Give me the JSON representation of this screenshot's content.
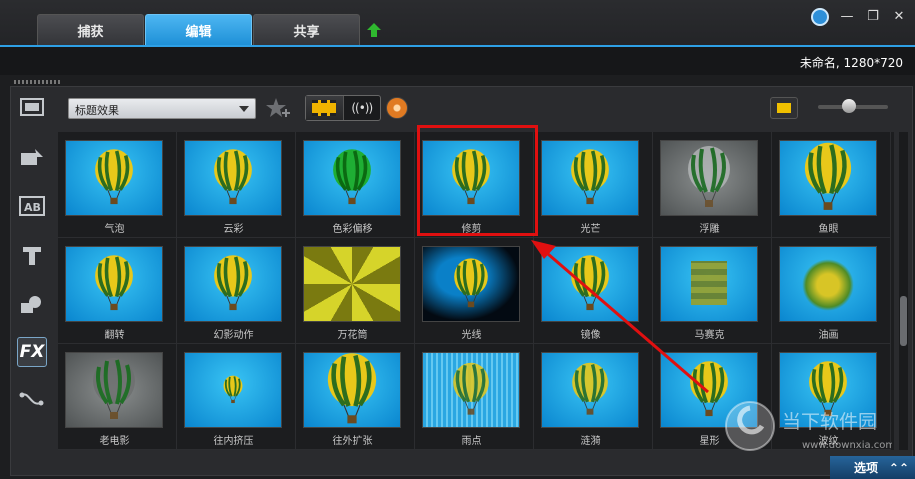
{
  "tabs": [
    {
      "label": "捕获",
      "active": false
    },
    {
      "label": "编辑",
      "active": true
    },
    {
      "label": "共享",
      "active": false
    }
  ],
  "project_info": "未命名, 1280*720",
  "toolbar": {
    "category": "标题效果"
  },
  "sidebar": [
    "media-icon",
    "transition-icon",
    "title-ab-icon",
    "text-t-icon",
    "graphics-icon",
    "fx-icon",
    "path-icon"
  ],
  "sidebar_fx_label": "FX",
  "effects": [
    {
      "label": "气泡",
      "thumb": "bubbles"
    },
    {
      "label": "云彩",
      "thumb": "clouds"
    },
    {
      "label": "色彩偏移",
      "thumb": "color"
    },
    {
      "label": "修剪",
      "thumb": "plain"
    },
    {
      "label": "光芒",
      "thumb": "flare"
    },
    {
      "label": "浮雕",
      "thumb": "emboss"
    },
    {
      "label": "鱼眼",
      "thumb": "fisheye"
    },
    {
      "label": "翻转",
      "thumb": "plain"
    },
    {
      "label": "幻影动作",
      "thumb": "plain"
    },
    {
      "label": "万花筒",
      "thumb": "kaleido"
    },
    {
      "label": "光线",
      "thumb": "spot"
    },
    {
      "label": "镜像",
      "thumb": "mirror"
    },
    {
      "label": "马赛克",
      "thumb": "mosaic"
    },
    {
      "label": "油画",
      "thumb": "oil"
    },
    {
      "label": "老电影",
      "thumb": "oldfilm"
    },
    {
      "label": "往内挤压",
      "thumb": "small"
    },
    {
      "label": "往外扩张",
      "thumb": "big"
    },
    {
      "label": "雨点",
      "thumb": "rain"
    },
    {
      "label": "涟漪",
      "thumb": "ripple"
    },
    {
      "label": "星形",
      "thumb": "star"
    },
    {
      "label": "波纹",
      "thumb": "plain"
    }
  ],
  "options_label": "选项",
  "watermark": {
    "main": "当下软件园",
    "sub": "www.downxia.com"
  },
  "colors": {
    "accent": "#2ea0e6",
    "highlight": "#e01010"
  }
}
